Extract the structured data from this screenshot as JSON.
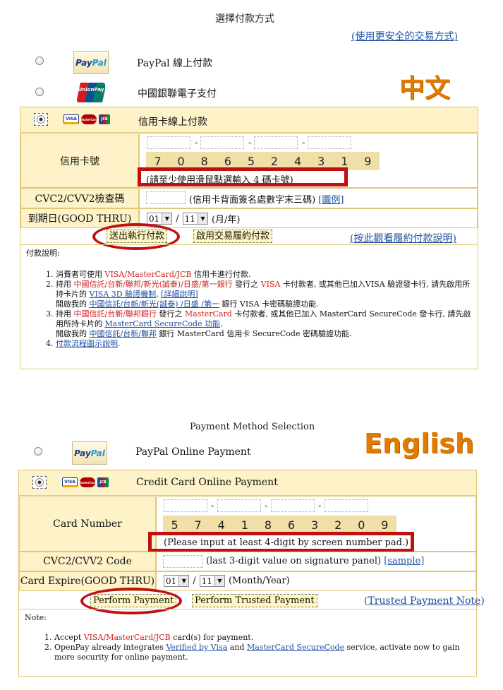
{
  "zh": {
    "title": "選擇付款方式",
    "secure_link": "(使用更安全的交易方式)",
    "lang_label": "中文",
    "paypal_label": "PayPal 線上付款",
    "unionpay_label": "中國銀聯電子支付",
    "credit_label": "信用卡線上付款",
    "card_number_label": "信用卡號",
    "digits": [
      "7",
      "0",
      "8",
      "6",
      "5",
      "2",
      "4",
      "3",
      "1",
      "9"
    ],
    "pad_hint": "(請至少使用滑鼠點選輸入 4 碼卡號)",
    "cvc_label": "CVC2/CVV2檢查碼",
    "cvc_hint": "(信用卡背面簽名處數字末三碼)",
    "cvc_link": "[圖例]",
    "expiry_label": "到期日(GOOD THRU)",
    "month": "01",
    "year": "11",
    "expiry_suffix": "(月/年)",
    "pay_button": "送出執行付款",
    "trusted_button": "啟用交易履約付款",
    "note_link": "(按此觀看履約付款說明)",
    "notes_title": "付款說明:",
    "note1_a": "消費者可使用 ",
    "note1_cards": "VISA/MasterCard/JCB",
    "note1_b": " 信用卡進行付款.",
    "note2_a": "持用 ",
    "note2_banks": "中國信託/台新/聯邦/新光(誠泰)/日盛/第一銀行",
    "note2_b": " 發行之 ",
    "note2_visa": "VISA",
    "note2_c": " 卡付款者, 或其他已加入VISA 驗證發卡行, 請先啟用所持卡片的 ",
    "note2_link1": "VISA 3D 驗證機制",
    "note2_d": ", ",
    "note2_link2": "[詳細說明]",
    "note2_e": "開啟我的 ",
    "note2_bank_links": "中國信託/台新/新光(誠泰) /日盛 /第一",
    "note2_f": " 銀行 VISA 卡密碼驗證功能.",
    "note3_a": "持用 ",
    "note3_banks": "中國信託/台新/聯邦銀行",
    "note3_b": " 發行之 ",
    "note3_mc": "MasterCard",
    "note3_c": " 卡付款者, 或其他已加入 MasterCard SecureCode 發卡行, 請先啟用所持卡片的 ",
    "note3_link": "MasterCard SecureCode 功能",
    "note3_d": ".",
    "note3_e": "開啟我的 ",
    "note3_bank_links": "中國信託/台新/聯邦",
    "note3_f": " 銀行 MasterCard 信用卡 SecureCode 密碼驗證功能.",
    "note4_link": "付款流程圖示說明",
    "note4_end": "."
  },
  "en": {
    "title": "Payment Method Selection",
    "lang_label": "English",
    "paypal_label": "PayPal Online Payment",
    "credit_label": "Credit Card Online Payment",
    "card_number_label": "Card Number",
    "digits": [
      "5",
      "7",
      "4",
      "1",
      "8",
      "6",
      "3",
      "2",
      "0",
      "9"
    ],
    "pad_hint": "(Please input at least 4-digit by screen number pad.)",
    "cvc_label": "CVC2/CVV2 Code",
    "cvc_hint": "(last 3-digit value on signature panel)",
    "cvc_link": "[sample]",
    "expiry_label": "Card Expire(GOOD THRU)",
    "month": "01",
    "year": "11",
    "expiry_suffix": "(Month/Year)",
    "pay_button": "Perform Payment",
    "trusted_button": "Perform Trusted Payment",
    "note_link_open": "(",
    "note_link": "Trusted Payment Note",
    "note_link_close": ")",
    "notes_title": "Note:",
    "note1_a": "Accept ",
    "note1_cards": "VISA/MasterCard/JCB",
    "note1_b": " card(s) for payment.",
    "note2_a": "OpenPay already integrates ",
    "note2_link1": "Verified by Visa",
    "note2_b": " and ",
    "note2_link2": "MasterCard SecureCode",
    "note2_c": " service, activate now to gain more security for online payment."
  },
  "icons": {
    "paypal_logo_a": "Pay",
    "paypal_logo_b": "Pal",
    "unionpay_logo": "UnionPay",
    "visa": "VISA",
    "mastercard": "MasterCard",
    "jcb": "JCB"
  },
  "colors": {
    "accent_border": "#e0c878",
    "label_bg": "#fdf2c8",
    "highlight": "#c01010",
    "link": "#1f4fa0"
  }
}
